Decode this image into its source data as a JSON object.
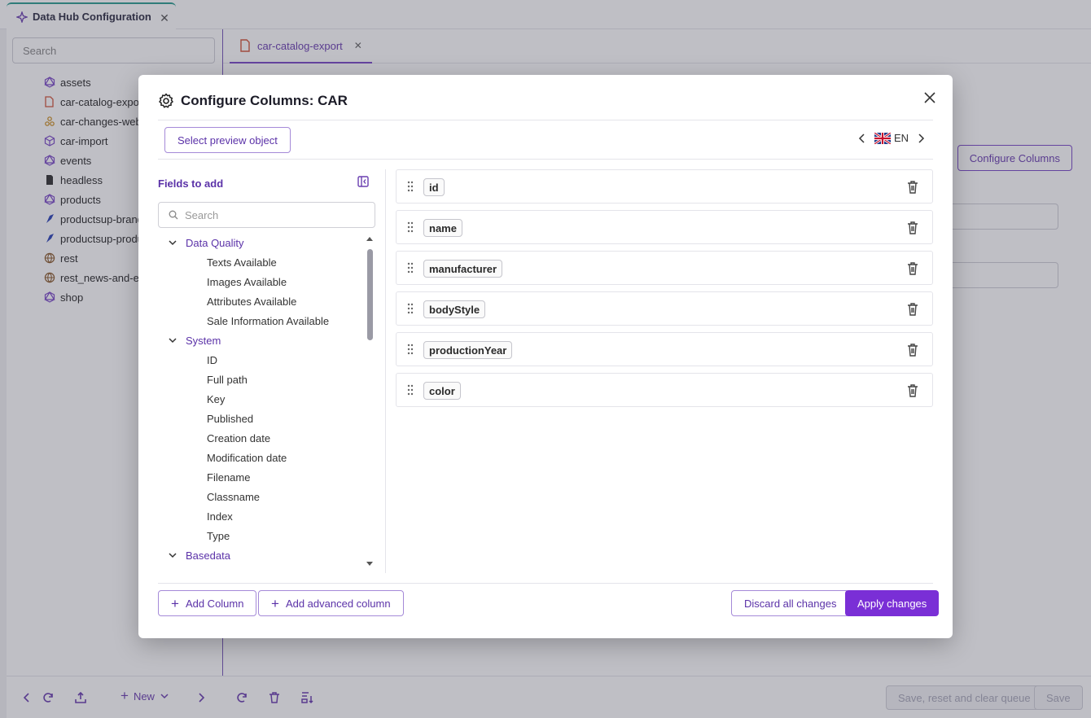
{
  "app": {
    "tab_title": "Data Hub Configuration",
    "sidebar_search_placeholder": "Search",
    "tree": [
      {
        "label": "assets",
        "icon": "graphql-icon"
      },
      {
        "label": "car-catalog-export",
        "icon": "file-export-icon"
      },
      {
        "label": "car-changes-webhook",
        "icon": "webhook-icon"
      },
      {
        "label": "car-import",
        "icon": "import-icon"
      },
      {
        "label": "events",
        "icon": "graphql-icon"
      },
      {
        "label": "headless",
        "icon": "document-icon"
      },
      {
        "label": "products",
        "icon": "graphql-icon"
      },
      {
        "label": "productsup-brands",
        "icon": "productsup-icon"
      },
      {
        "label": "productsup-products",
        "icon": "productsup-icon"
      },
      {
        "label": "rest",
        "icon": "globe-icon"
      },
      {
        "label": "rest_news-and-events",
        "icon": "globe-icon"
      },
      {
        "label": "shop",
        "icon": "graphql-icon"
      }
    ],
    "content_tab": "car-catalog-export",
    "configure_columns_button": "Configure Columns",
    "bottom": {
      "new_label": "New",
      "save_reset_label": "Save, reset and clear queue",
      "save_label": "Save"
    }
  },
  "modal": {
    "title": "Configure Columns: CAR",
    "select_preview_label": "Select preview object",
    "language": "EN",
    "fields_to_add_title": "Fields to add",
    "search_placeholder": "Search",
    "groups": [
      {
        "label": "Data Quality",
        "items": [
          "Texts Available",
          "Images Available",
          "Attributes Available",
          "Sale Information Available"
        ]
      },
      {
        "label": "System",
        "items": [
          "ID",
          "Full path",
          "Key",
          "Published",
          "Creation date",
          "Modification date",
          "Filename",
          "Classname",
          "Index",
          "Type"
        ]
      },
      {
        "label": "Basedata",
        "items": []
      }
    ],
    "columns": [
      "id",
      "name",
      "manufacturer",
      "bodyStyle",
      "productionYear",
      "color"
    ],
    "add_column_label": "Add Column",
    "add_advanced_column_label": "Add advanced column",
    "discard_label": "Discard all changes",
    "apply_label": "Apply changes"
  },
  "colors": {
    "accent": "#7a2fd6",
    "accent_text": "#5b32a8",
    "tab_indicator": "#2b9d8f"
  }
}
